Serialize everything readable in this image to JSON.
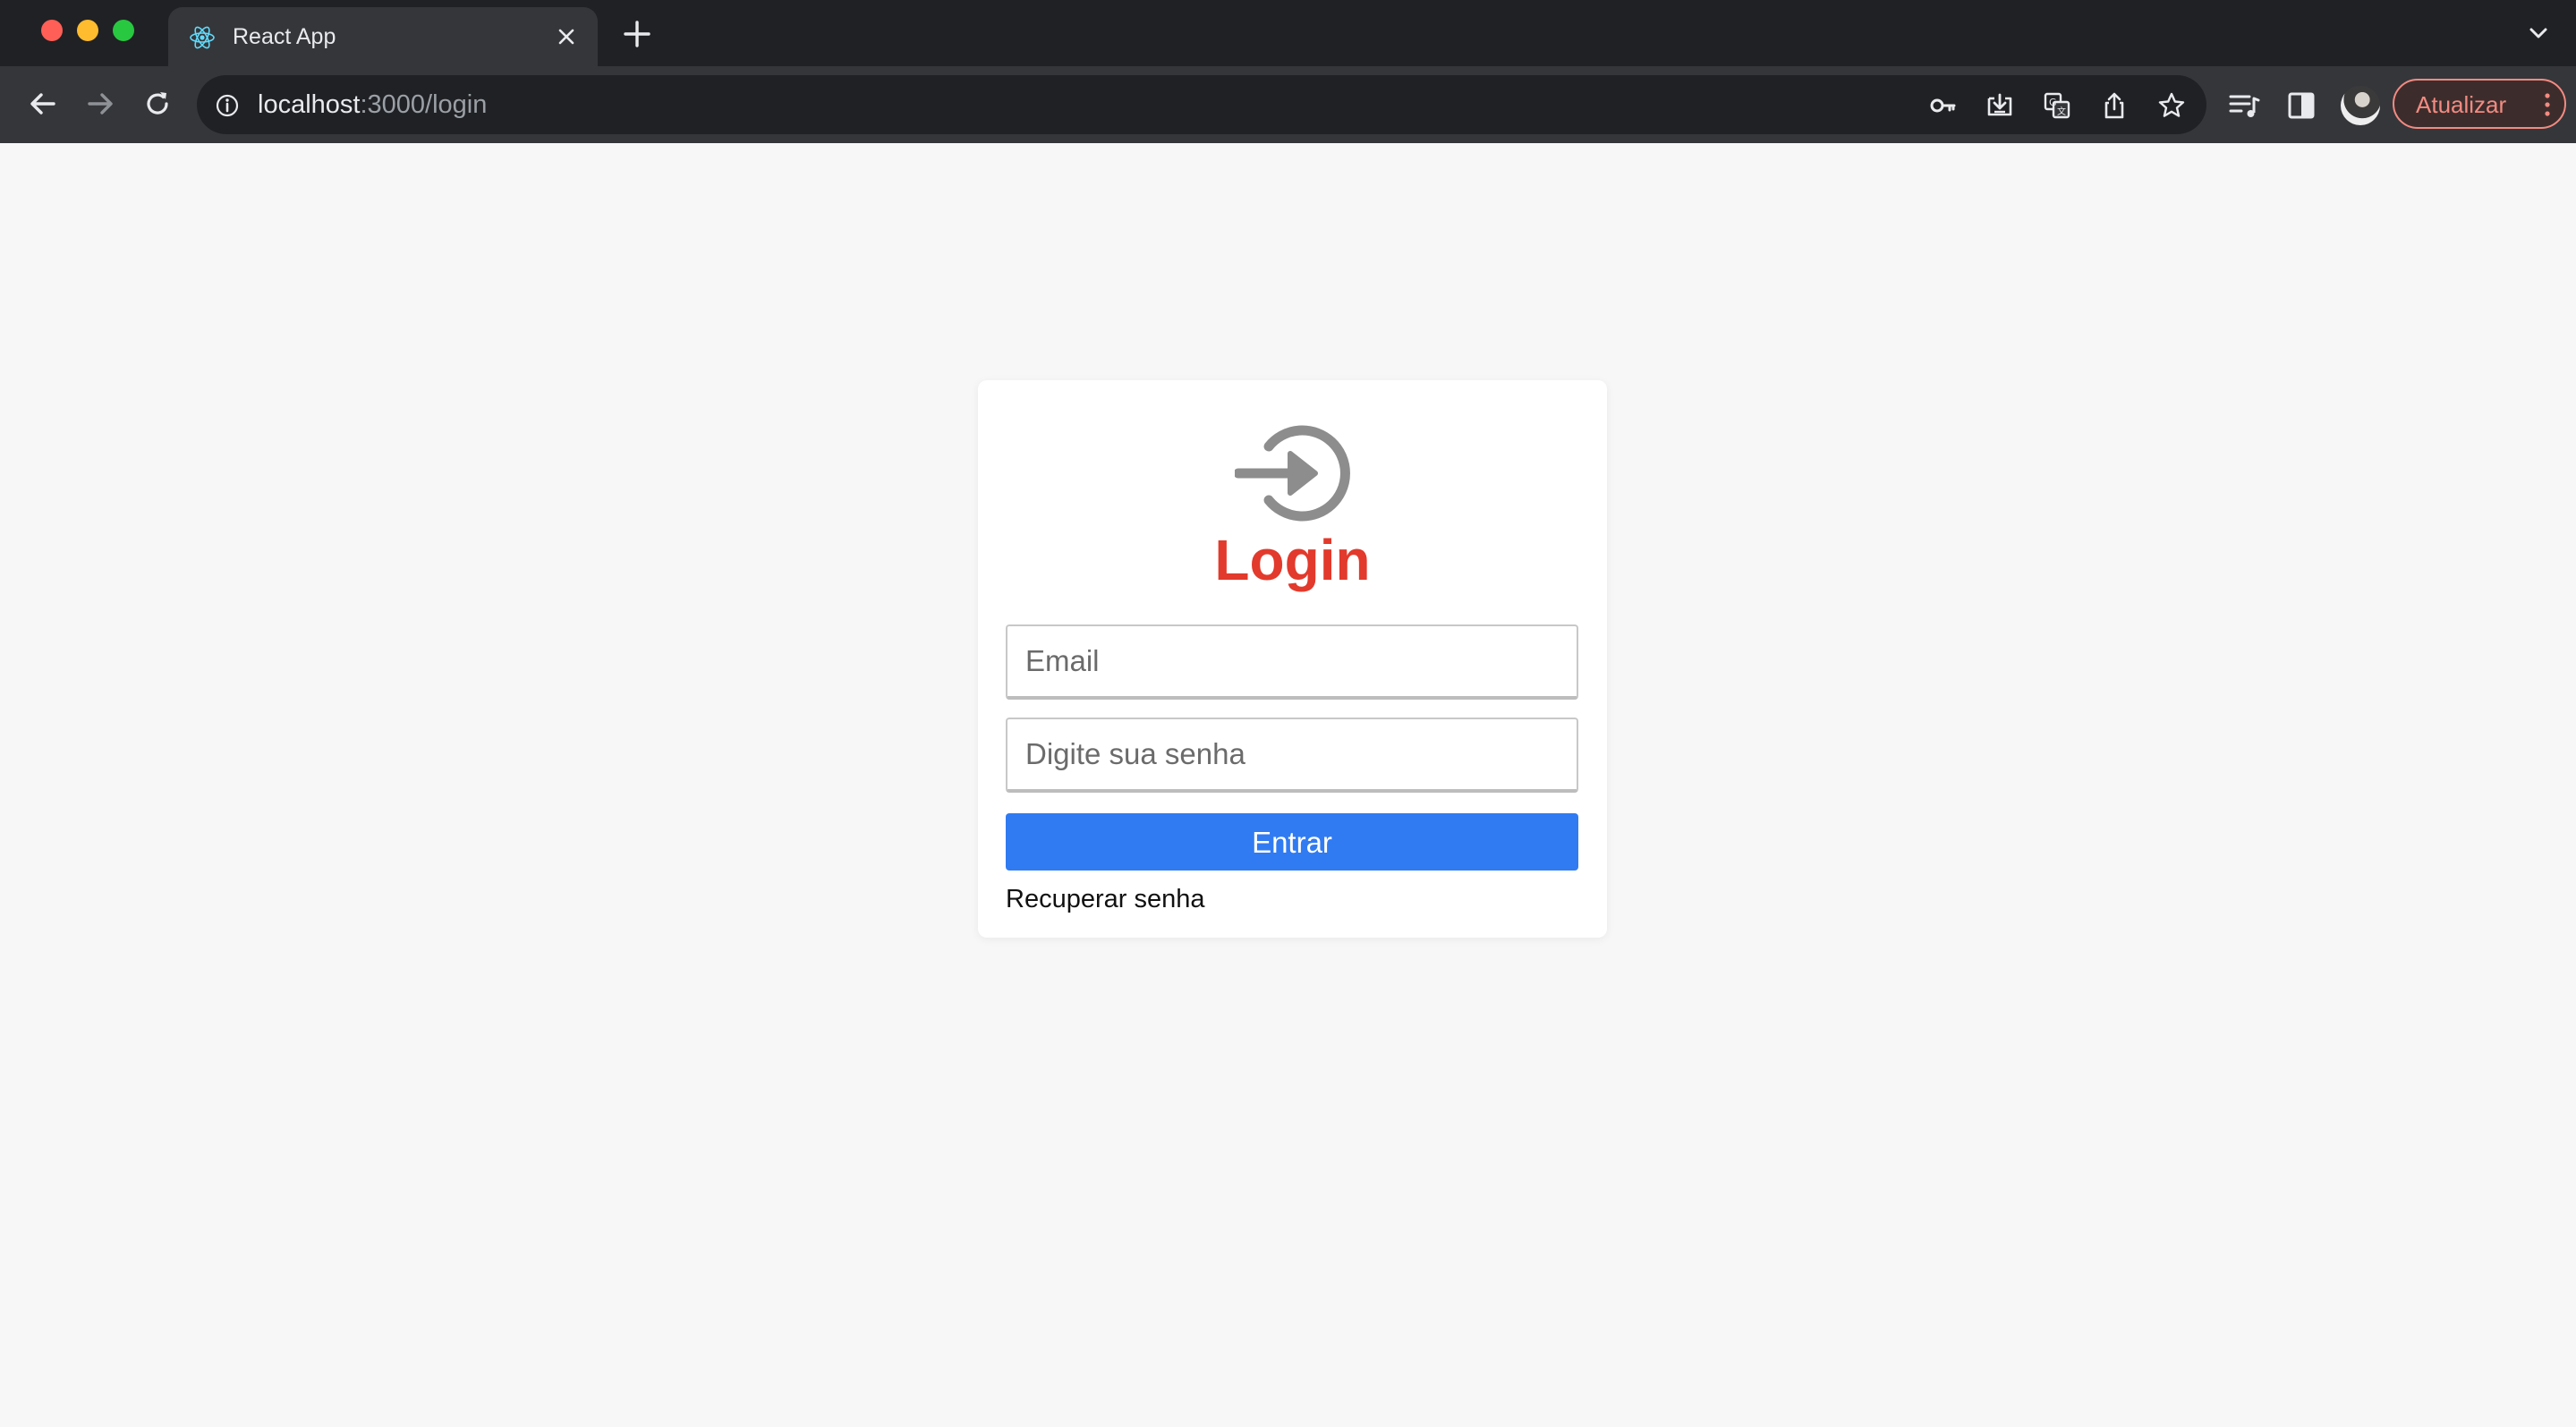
{
  "browser": {
    "tab": {
      "title": "React App",
      "favicon": "react-icon"
    },
    "address_bar": {
      "host": "localhost",
      "path": ":3000/login"
    },
    "update_button": {
      "label": "Atualizar",
      "color": "#f28b82"
    }
  },
  "login_page": {
    "icon": "login-arrow-icon",
    "title": "Login",
    "title_color": "#e23a2c",
    "email_placeholder": "Email",
    "password_placeholder": "Digite sua senha",
    "submit_label": "Entrar",
    "submit_color": "#307bf2",
    "recover_label": "Recuperar senha"
  }
}
